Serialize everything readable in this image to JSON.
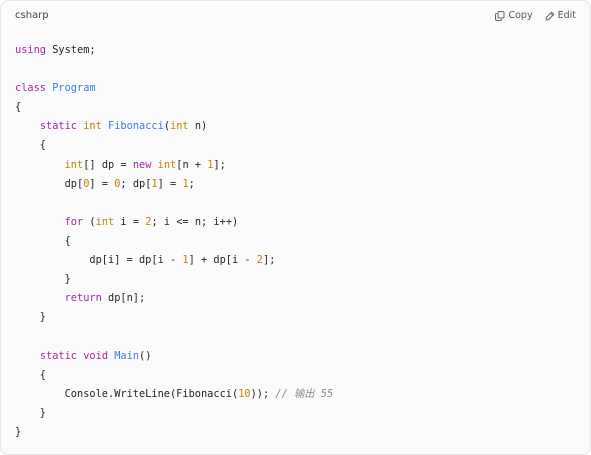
{
  "header": {
    "language": "csharp",
    "copy_label": "Copy",
    "edit_label": "Edit"
  },
  "code_lines": [
    [
      {
        "c": "k",
        "t": "using"
      },
      {
        "c": "p",
        "t": " System;"
      }
    ],
    [],
    [
      {
        "c": "k",
        "t": "class"
      },
      {
        "c": "p",
        "t": " "
      },
      {
        "c": "f",
        "t": "Program"
      }
    ],
    [
      {
        "c": "p",
        "t": "{"
      }
    ],
    [
      {
        "c": "p",
        "t": "    "
      },
      {
        "c": "k",
        "t": "static"
      },
      {
        "c": "p",
        "t": " "
      },
      {
        "c": "t",
        "t": "int"
      },
      {
        "c": "p",
        "t": " "
      },
      {
        "c": "f",
        "t": "Fibonacci"
      },
      {
        "c": "p",
        "t": "("
      },
      {
        "c": "t",
        "t": "int"
      },
      {
        "c": "p",
        "t": " n)"
      }
    ],
    [
      {
        "c": "p",
        "t": "    {"
      }
    ],
    [
      {
        "c": "p",
        "t": "        "
      },
      {
        "c": "t",
        "t": "int"
      },
      {
        "c": "p",
        "t": "[] dp = "
      },
      {
        "c": "k",
        "t": "new"
      },
      {
        "c": "p",
        "t": " "
      },
      {
        "c": "t",
        "t": "int"
      },
      {
        "c": "p",
        "t": "[n + "
      },
      {
        "c": "n",
        "t": "1"
      },
      {
        "c": "p",
        "t": "];"
      }
    ],
    [
      {
        "c": "p",
        "t": "        dp["
      },
      {
        "c": "n",
        "t": "0"
      },
      {
        "c": "p",
        "t": "] = "
      },
      {
        "c": "n",
        "t": "0"
      },
      {
        "c": "p",
        "t": "; dp["
      },
      {
        "c": "n",
        "t": "1"
      },
      {
        "c": "p",
        "t": "] = "
      },
      {
        "c": "n",
        "t": "1"
      },
      {
        "c": "p",
        "t": ";"
      }
    ],
    [],
    [
      {
        "c": "p",
        "t": "        "
      },
      {
        "c": "k",
        "t": "for"
      },
      {
        "c": "p",
        "t": " ("
      },
      {
        "c": "t",
        "t": "int"
      },
      {
        "c": "p",
        "t": " i = "
      },
      {
        "c": "n",
        "t": "2"
      },
      {
        "c": "p",
        "t": "; i <= n; i++)"
      }
    ],
    [
      {
        "c": "p",
        "t": "        {"
      }
    ],
    [
      {
        "c": "p",
        "t": "            dp[i] = dp[i - "
      },
      {
        "c": "n",
        "t": "1"
      },
      {
        "c": "p",
        "t": "] + dp[i - "
      },
      {
        "c": "n",
        "t": "2"
      },
      {
        "c": "p",
        "t": "];"
      }
    ],
    [
      {
        "c": "p",
        "t": "        }"
      }
    ],
    [
      {
        "c": "p",
        "t": "        "
      },
      {
        "c": "k",
        "t": "return"
      },
      {
        "c": "p",
        "t": " dp[n];"
      }
    ],
    [
      {
        "c": "p",
        "t": "    }"
      }
    ],
    [],
    [
      {
        "c": "p",
        "t": "    "
      },
      {
        "c": "k",
        "t": "static"
      },
      {
        "c": "p",
        "t": " "
      },
      {
        "c": "k",
        "t": "void"
      },
      {
        "c": "p",
        "t": " "
      },
      {
        "c": "f",
        "t": "Main"
      },
      {
        "c": "p",
        "t": "()"
      }
    ],
    [
      {
        "c": "p",
        "t": "    {"
      }
    ],
    [
      {
        "c": "p",
        "t": "        Console.WriteLine(Fibonacci("
      },
      {
        "c": "n",
        "t": "10"
      },
      {
        "c": "p",
        "t": ")); "
      },
      {
        "c": "c",
        "t": "// 输出 55"
      }
    ],
    [
      {
        "c": "p",
        "t": "    }"
      }
    ],
    [
      {
        "c": "p",
        "t": "}"
      }
    ]
  ]
}
